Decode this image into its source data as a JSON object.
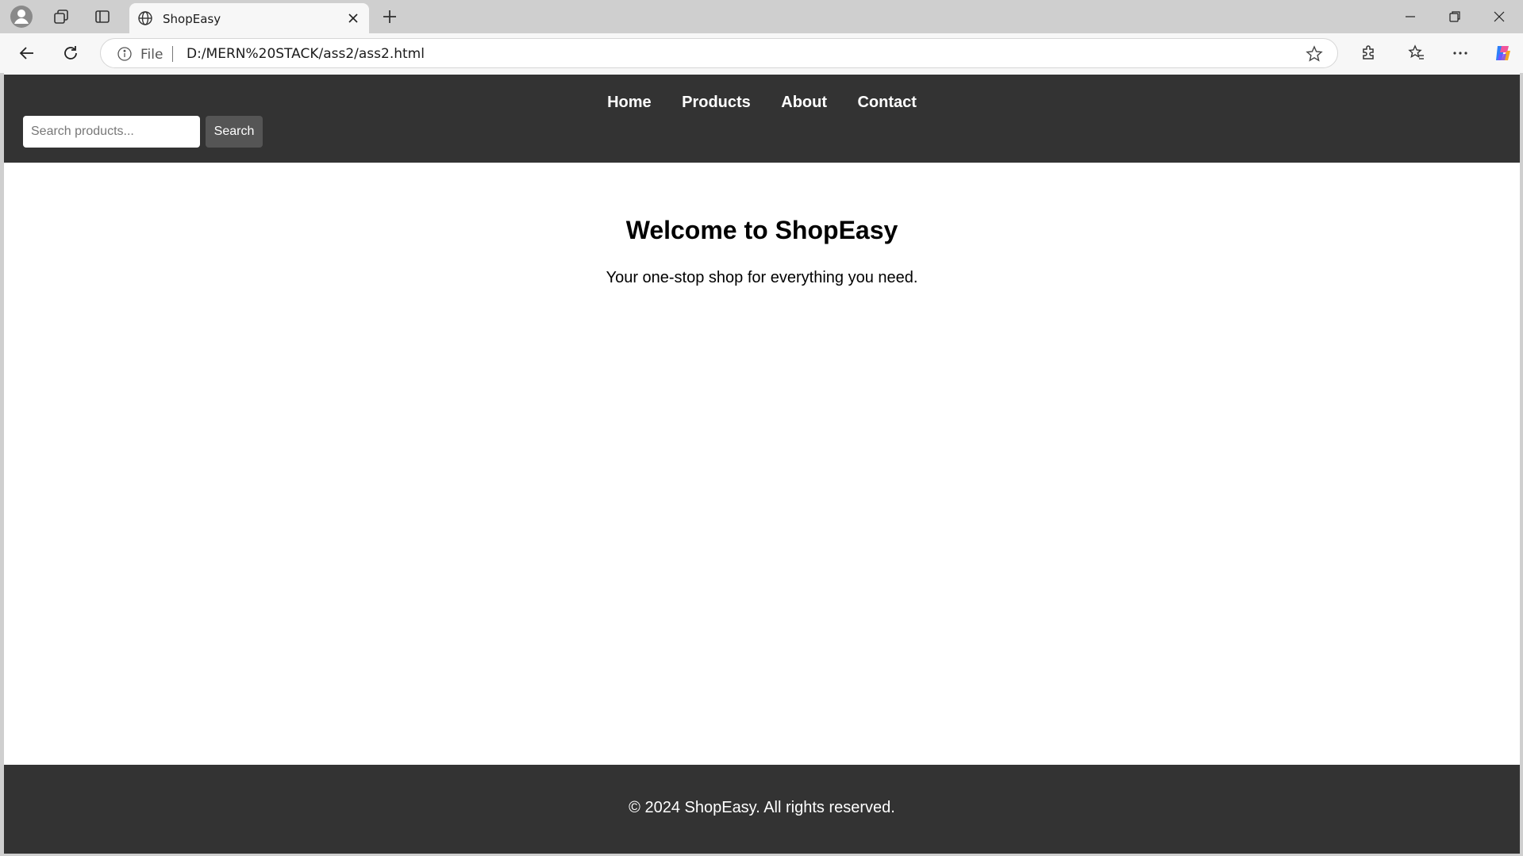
{
  "browser": {
    "tab": {
      "title": "ShopEasy"
    },
    "address": {
      "scheme": "File",
      "url": "D:/MERN%20STACK/ass2/ass2.html"
    }
  },
  "icons": {
    "profile": "profile-icon",
    "workspaces": "workspaces-icon",
    "vertical_tabs": "vertical-tabs-icon",
    "globe": "globe-icon",
    "close": "close-icon",
    "plus": "plus-icon",
    "minimize": "minimize-icon",
    "restore": "restore-icon",
    "window_close": "window-close-icon",
    "back": "back-arrow-icon",
    "reload": "reload-icon",
    "info": "info-icon",
    "star": "star-icon",
    "extensions": "extensions-icon",
    "favorites": "favorites-icon",
    "more": "more-icon",
    "copilot": "copilot-icon"
  },
  "site": {
    "nav": [
      "Home",
      "Products",
      "About",
      "Contact"
    ],
    "search": {
      "placeholder": "Search products...",
      "button_label": "Search"
    },
    "hero": {
      "title": "Welcome to ShopEasy",
      "subtitle": "Your one-stop shop for everything you need."
    },
    "footer": {
      "text": "© 2024 ShopEasy. All rights reserved."
    }
  },
  "colors": {
    "header_bg": "#333333",
    "footer_bg": "#333333",
    "search_button_bg": "#555555",
    "nav_text": "#ffffff",
    "page_bg": "#ffffff"
  }
}
